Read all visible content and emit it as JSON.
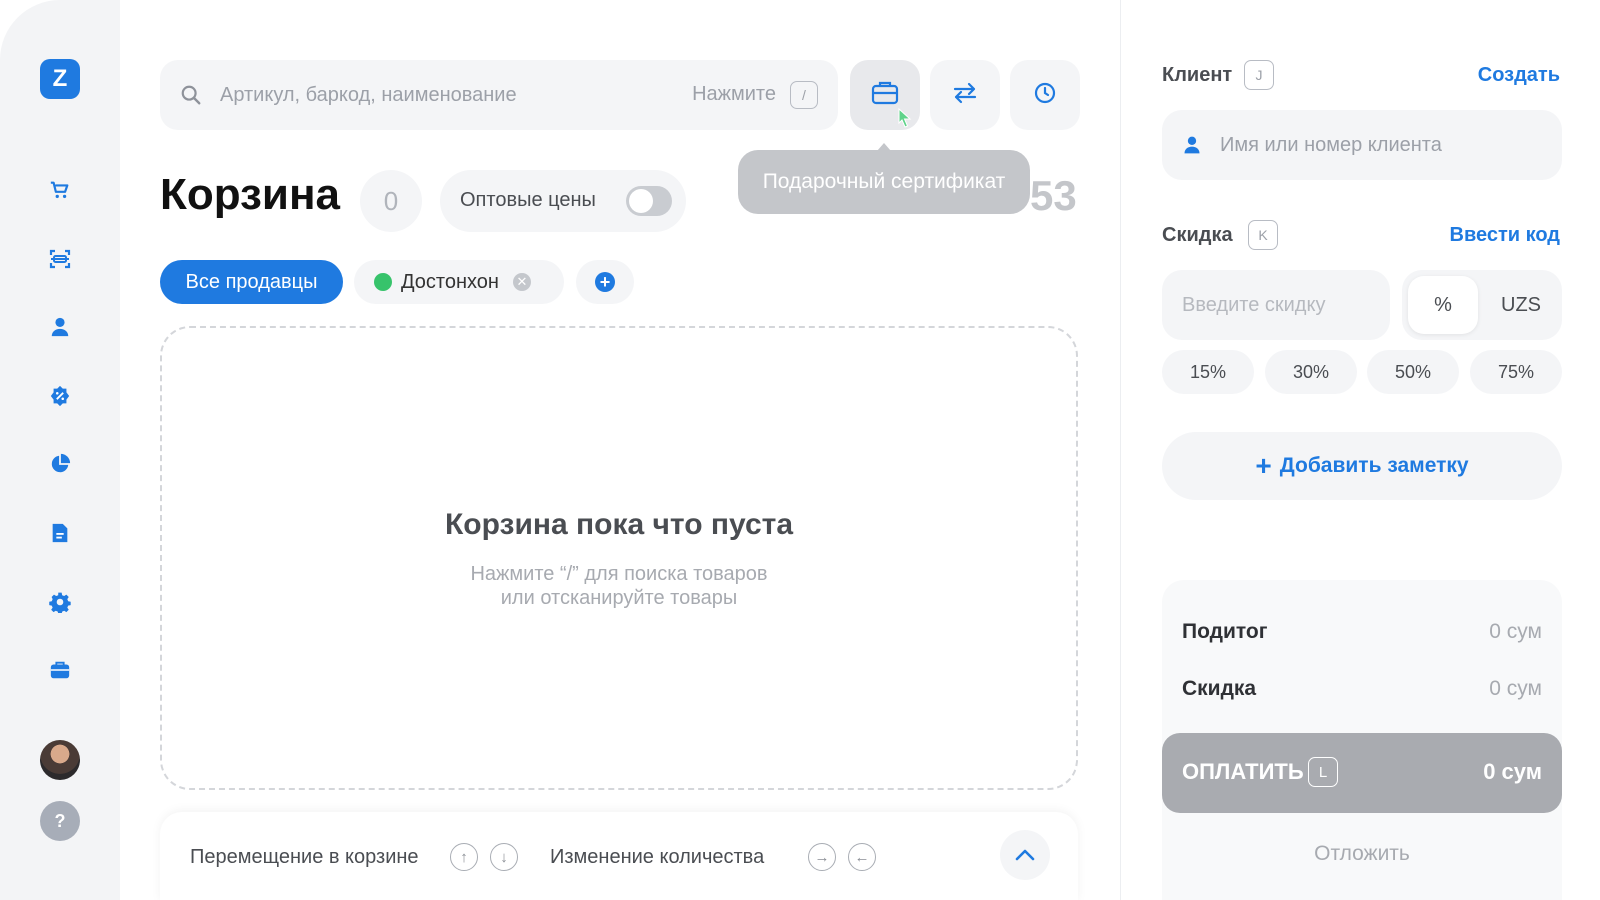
{
  "sidebar": {
    "logo": "Z",
    "items": [
      {
        "name": "cart-icon"
      },
      {
        "name": "scanner-icon"
      },
      {
        "name": "user-icon"
      },
      {
        "name": "discount-badge-icon"
      },
      {
        "name": "pie-chart-icon"
      },
      {
        "name": "document-icon"
      },
      {
        "name": "gear-icon"
      },
      {
        "name": "briefcase-icon"
      }
    ],
    "help": "?"
  },
  "search": {
    "placeholder": "Артикул, баркод, наименование",
    "hint": "Нажмите",
    "shortcut": "/"
  },
  "toolbar": {
    "tooltip": "Подарочный сертификат",
    "behind_text": "53"
  },
  "cart": {
    "title": "Корзина",
    "count": "0",
    "wholesale_label": "Оптовые цены",
    "wholesale_enabled": false,
    "all_sellers": "Все продавцы",
    "seller": "Достонхон",
    "empty_title": "Корзина пока что пуста",
    "empty_line1": "Нажмите “/” для поиска товаров",
    "empty_line2": "или отсканируйте товары"
  },
  "bottom": {
    "move_label": "Перемещение в корзине",
    "qty_label": "Изменение количества"
  },
  "client": {
    "label": "Клиент",
    "shortcut": "J",
    "create": "Создать",
    "placeholder": "Имя или номер клиента"
  },
  "discount": {
    "label": "Скидка",
    "shortcut": "K",
    "enter_code": "Ввести код",
    "placeholder": "Введите скидку",
    "unit_percent": "%",
    "unit_currency": "UZS",
    "presets": [
      "15%",
      "30%",
      "50%",
      "75%"
    ]
  },
  "note": {
    "label": "Добавить заметку"
  },
  "summary": {
    "subtotal_label": "Подитог",
    "subtotal_value": "0 сум",
    "discount_label": "Скидка",
    "discount_value": "0 сум",
    "pay_label": "ОПЛАТИТЬ",
    "pay_shortcut": "L",
    "pay_amount": "0 сум",
    "postpone": "Отложить"
  },
  "colors": {
    "accent": "#1f7ae0",
    "seller_dot": "#37c36b",
    "pay_disabled": "#a9abb0"
  }
}
